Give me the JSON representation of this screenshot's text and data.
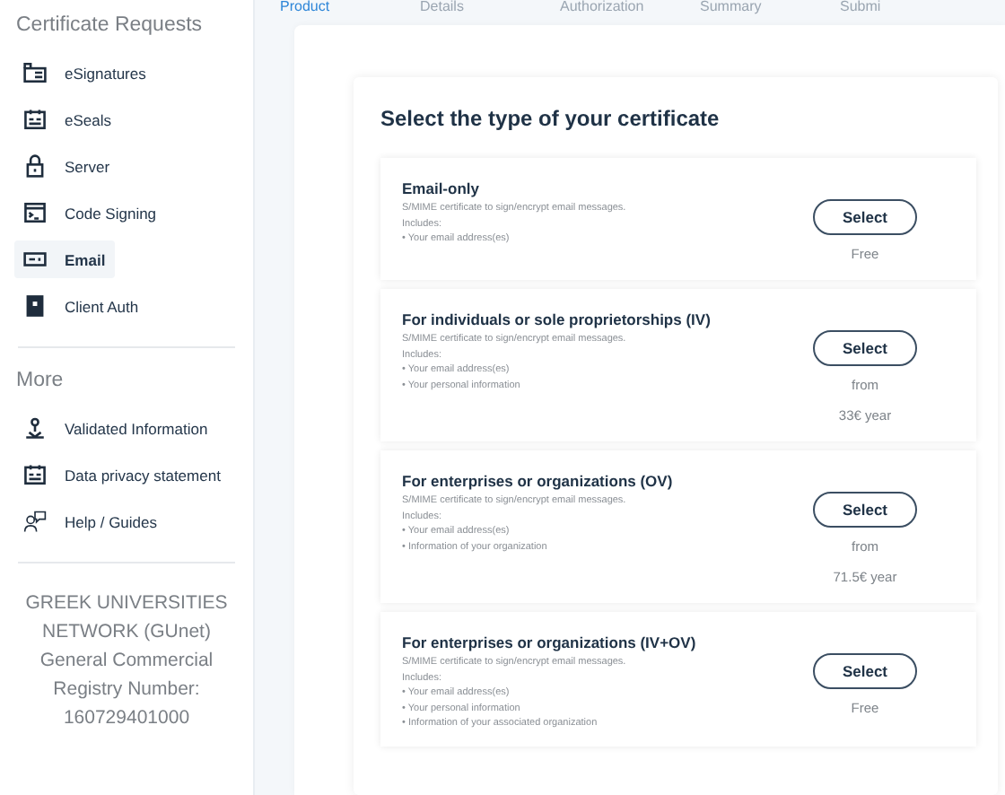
{
  "steps": [
    {
      "label": "Product",
      "selected": true
    },
    {
      "label": "Details",
      "selected": false
    },
    {
      "label": "Authorization",
      "selected": false
    },
    {
      "label": "Summary",
      "selected": false
    },
    {
      "label": "Submi",
      "selected": false
    }
  ],
  "sidebar": {
    "sections": [
      {
        "heading": "Certificate Requests",
        "items": [
          {
            "label": "eSignatures",
            "selected": false
          },
          {
            "label": "eSeals",
            "selected": false
          },
          {
            "label": "Server",
            "selected": false
          },
          {
            "label": "Code Signing",
            "selected": false
          },
          {
            "label": "Email",
            "selected": true
          },
          {
            "label": "Client Auth",
            "selected": false
          }
        ]
      },
      {
        "heading": "More",
        "items": [
          {
            "label": "Validated Information",
            "selected": false
          },
          {
            "label": "Data privacy statement",
            "selected": false
          },
          {
            "label": "Help / Guides",
            "selected": false
          }
        ]
      }
    ],
    "footer": [
      "GREEK UNIVERSITIES",
      "NETWORK (GUnet)",
      "General Commercial",
      "Registry Number:",
      "160729401000"
    ]
  },
  "panel": {
    "title": "Select the type of your certificate",
    "options": [
      {
        "title": "Email-only",
        "description": "S/MIME certificate to sign/encrypt email messages.",
        "includes_label": "Includes:",
        "includes": [
          "• Your email address(es)"
        ],
        "button": "Select",
        "price": [
          "Free"
        ]
      },
      {
        "title": "For individuals or sole proprietorships (IV)",
        "description": "S/MIME certificate to sign/encrypt email messages.",
        "includes_label": "Includes:",
        "includes": [
          "• Your email address(es)",
          "• Your personal information"
        ],
        "button": "Select",
        "price": [
          "from",
          "33€ year"
        ]
      },
      {
        "title": "For enterprises or organizations (OV)",
        "description": "S/MIME certificate to sign/encrypt email messages.",
        "includes_label": "Includes:",
        "includes": [
          "• Your email address(es)",
          "• Information of your organization"
        ],
        "button": "Select",
        "price": [
          "from",
          "71.5€ year"
        ]
      },
      {
        "title": "For enterprises or organizations (IV+OV)",
        "description": "S/MIME certificate to sign/encrypt email messages.",
        "includes_label": "Includes:",
        "includes": [
          "• Your email address(es)",
          "• Your personal information",
          "• Information of your associated organization"
        ],
        "button": "Select",
        "price": [
          "Free"
        ]
      }
    ]
  }
}
